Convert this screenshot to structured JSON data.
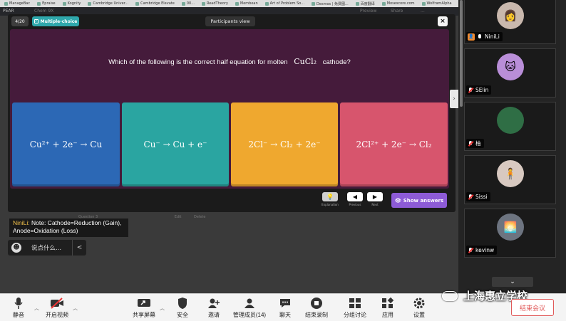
{
  "bookmarks": [
    "ManageBac",
    "Epraise",
    "Kognity",
    "Cambridge Univer...",
    "Cambridge Elevate",
    "00...",
    "ReadTheory",
    "Membean",
    "Art of Problem So...",
    "Desmos | 免费图...",
    "百度翻译",
    "Mosescore.com",
    "WolframAlpha"
  ],
  "app": {
    "logo": "PEAR",
    "left_text": "Chem 9X",
    "right_items": [
      "Preview",
      "Share",
      "..."
    ]
  },
  "quiz": {
    "counter": "4/20",
    "type_label": "Multiple-choice",
    "view_label": "Participants view",
    "close": "×",
    "question_before": "Which of the following is the correct half equation for molten",
    "question_formula": "CuCl₂",
    "question_after": "cathode?",
    "options": [
      "Cu²⁺ + 2e⁻ → Cu",
      "Cu⁻ → Cu + e⁻",
      "2Cl⁻ → Cl₂ + 2e⁻",
      "2Cl²⁺ + 2e⁻ → Cl₂"
    ],
    "controls": [
      {
        "label": "Explanation",
        "icon": "💡"
      },
      {
        "label": "Previous",
        "icon": "◀"
      },
      {
        "label": "Next",
        "icon": "▶"
      }
    ],
    "show_answers": "Show answers",
    "lower_strip": [
      "Question 3",
      "Edit",
      "Delete"
    ]
  },
  "chat": {
    "sender": "NiniLi:",
    "message": "Note: Cathode=Reduction (Gain), Anode=Oxidation (Loss)",
    "input_placeholder": "说点什么...",
    "collapse": "<"
  },
  "participants": [
    {
      "name": "NiniLi",
      "avatar_color": "#c9b8ad",
      "host": true,
      "mic": "on"
    },
    {
      "name": "SElin",
      "avatar_color": "#b98ed8",
      "host": false,
      "mic": "off"
    },
    {
      "name": "柚",
      "avatar_color": "#2f6e45",
      "host": false,
      "mic": "off"
    },
    {
      "name": "Sissi",
      "avatar_color": "#d8c9c1",
      "host": false,
      "mic": "off"
    },
    {
      "name": "kevinw",
      "avatar_color": "#6d7480",
      "host": false,
      "mic": "off"
    }
  ],
  "side_scroll_down": "⌄",
  "toolbar": {
    "mute": "静音",
    "video": "开启视频",
    "share": "共享屏幕",
    "security": "安全",
    "invite": "邀请",
    "members": "管理成员(14)",
    "chat": "聊天",
    "record": "结束录制",
    "breakout": "分组讨论",
    "apps": "应用",
    "settings": "设置",
    "end": "结束会议"
  },
  "watermark": "上海惠立学校"
}
